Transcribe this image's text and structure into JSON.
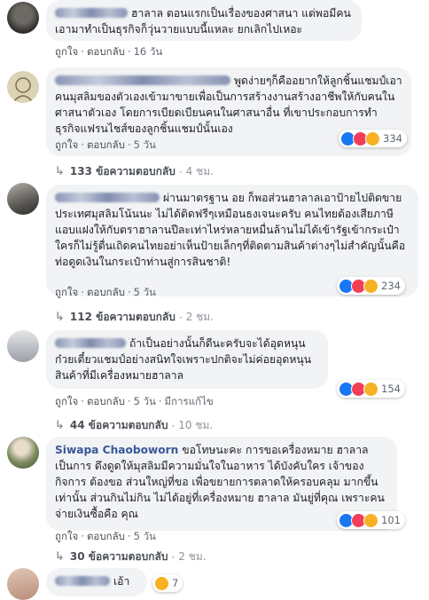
{
  "comments": [
    {
      "text": "ฮาลาล ตอนแรกเป็นเรื่องของศาสนา แต่พอมีคนเอามาทำเป็นธุรกิจก็วุ่นวายแบบนี้แหละ ยกเลิกไปเหอะ",
      "like": "ถูกใจ",
      "reply": "ตอบกลับ",
      "time": "16 วัน"
    },
    {
      "text": "พูดง่ายๆก็คืออยากให้ลูกชิ้นแชมป์เอาคนมุสลิมของตัวเองเข้ามาขายเพื่อเป็นการสร้างงานสร้างอาชีพให้กับคนในศาสนาตัวเอง โดยการเบียดเบียนคนในศาสนาอื่น ที่เขาประกอบการทำธุรกิจแฟรนไชส์ของลูกชิ้นแชมป์นั้นเอง",
      "like": "ถูกใจ",
      "reply": "ตอบกลับ",
      "time": "5 วัน",
      "reaction_count": "334",
      "replies_label": "133 ข้อความตอบกลับ",
      "replies_time": "4 ชม."
    },
    {
      "text": "ผ่านมาตรฐาน อย ก็พอส่วนฮาลาลเอาป้ายไปติดขายประเทศมุสลิมโน้นนะ ไม่ได้ติดฟรีๆเหมือนธงเจนะครับ คนไทยต้องเสียภาษีแอบแฝงให้กับตราฮาลานปีละเท่าไหร่หลายหมื่นล้านไม่ได้เข้ารัฐเข้ากระเป๋าใครก็ไม่รู้ตื่นเถิดคนไทยอย่าเห็นป้ายเล็กๆที่ติดตามสินค้าต่างๆไม่สำคัญนั้นคือท่อดูดเงินในกระเป๋าท่านสู่การสินชาติ!",
      "like": "ถูกใจ",
      "reply": "ตอบกลับ",
      "time": "5 วัน",
      "reaction_count": "234",
      "replies_label": "112 ข้อความตอบกลับ",
      "replies_time": "2 ชม."
    },
    {
      "text": "ถ้าเป็นอย่างนั้นก็ดีนะครับจะได้อุดหนุนก๋วยเตี๋ยวแชมป์อย่างสนิทใจเพราะปกติจะไม่ค่อยอุดหนุนสินค้าที่มีเครื่องหมายฮาลาล",
      "like": "ถูกใจ",
      "reply": "ตอบกลับ",
      "time": "5 วัน",
      "edited": "มีการแก้ไข",
      "reaction_count": "154",
      "replies_label": "44 ข้อความตอบกลับ",
      "replies_time": "10 ชม."
    },
    {
      "author": "Siwapa Chaoboworn",
      "text": "ขอโทษนะคะ การขอเครื่องหมาย ฮาลาลเป็นการ ดึงดูดให้มุสลิมมีความมั่นใจในอาหาร ได้บังคับใคร เจ้าของกิจการ ต้องขอ ส่วนใหญ่ที่ขอ เพื่อขยายการตลาดให้ครอบคลุม มากขึ้นเท่านั้น ส่วนกินไม่กิน ไม่ได้อยู่ที่เครื่องหมาย ฮาลาล มันยู่ที่คุณ เพราะคนจ่ายเงินซื้อคือ คุณ",
      "like": "ถูกใจ",
      "reply": "ตอบกลับ",
      "time": "5 วัน",
      "reaction_count": "101",
      "replies_label": "30 ข้อความตอบกลับ",
      "replies_time": "2 ชม."
    },
    {
      "text": "เอ้า",
      "reaction_count": "7"
    }
  ],
  "colors": {
    "link": "#385898",
    "bubble": "#f2f3f5",
    "like": "#1877f2",
    "love": "#f33e58",
    "haha": "#f7b125"
  }
}
